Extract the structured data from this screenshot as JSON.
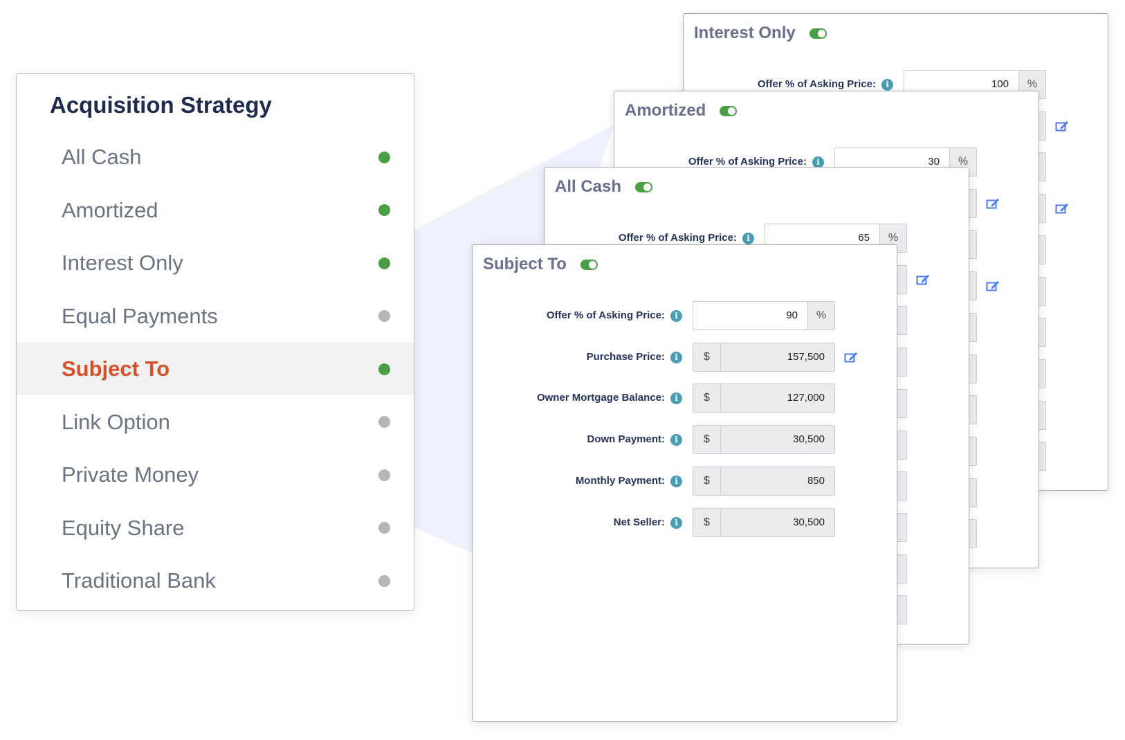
{
  "sidebar": {
    "title": "Acquisition Strategy",
    "items": [
      {
        "label": "All Cash",
        "enabled": true
      },
      {
        "label": "Amortized",
        "enabled": true
      },
      {
        "label": "Interest Only",
        "enabled": true
      },
      {
        "label": "Equal Payments",
        "enabled": false
      },
      {
        "label": "Subject To",
        "enabled": true,
        "active": true
      },
      {
        "label": "Link Option",
        "enabled": false
      },
      {
        "label": "Private Money",
        "enabled": false
      },
      {
        "label": "Equity Share",
        "enabled": false
      },
      {
        "label": "Traditional Bank",
        "enabled": false
      }
    ]
  },
  "colors": {
    "enabled_dot": "#4a9f45",
    "disabled_dot": "#b3b6bb",
    "active": "#d8502a",
    "title": "#1e2b4f"
  },
  "cards": [
    {
      "title": "Interest Only",
      "toggle_on": true,
      "rows": [
        {
          "label": "Offer % of Asking Price:",
          "value": "100",
          "suffix": "%"
        }
      ],
      "edit_rows": [
        1,
        3
      ],
      "extra_rows": 9
    },
    {
      "title": "Amortized",
      "toggle_on": true,
      "rows": [
        {
          "label": "Offer % of Asking Price:",
          "value": "30",
          "suffix": "%"
        }
      ],
      "edit_rows": [
        1,
        3
      ],
      "extra_rows": 9
    },
    {
      "title": "All Cash",
      "toggle_on": true,
      "rows": [
        {
          "label": "Offer % of Asking Price:",
          "value": "65",
          "suffix": "%"
        }
      ],
      "edit_rows": [
        1
      ],
      "extra_rows": 9
    },
    {
      "title": "Subject To",
      "toggle_on": true,
      "rows": [
        {
          "label": "Offer % of Asking Price:",
          "value": "90",
          "suffix": "%"
        },
        {
          "label": "Purchase Price:",
          "value": "157,500",
          "prefix": "$"
        },
        {
          "label": "Owner Mortgage Balance:",
          "value": "127,000",
          "prefix": "$"
        },
        {
          "label": "Down Payment:",
          "value": "30,500",
          "prefix": "$"
        },
        {
          "label": "Monthly Payment:",
          "value": "850",
          "prefix": "$"
        },
        {
          "label": "Net Seller:",
          "value": "30,500",
          "prefix": "$"
        }
      ],
      "edit_rows": [
        1
      ],
      "extra_rows": 0
    }
  ]
}
